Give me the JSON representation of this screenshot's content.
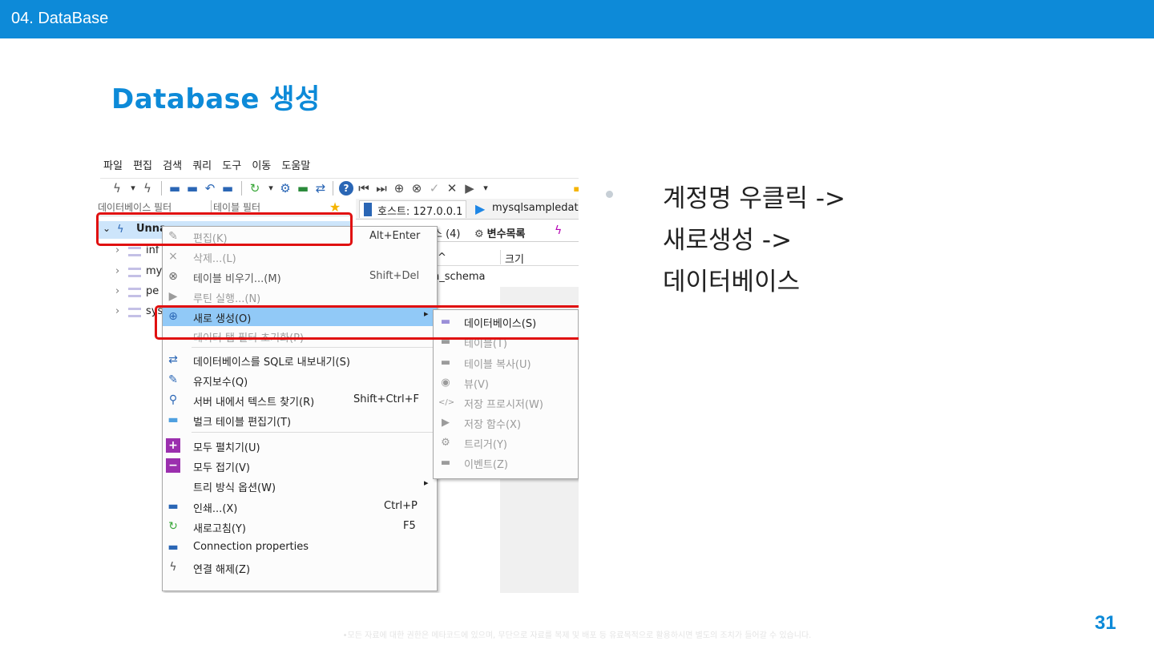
{
  "header": {
    "section": "04. DataBase"
  },
  "slide": {
    "title": "Database 생성",
    "bullet": [
      "계정명 우클릭 ->",
      "새로생성 ->",
      "데이터베이스"
    ],
    "page_number": "31",
    "footer_note": "•모든 자료에 대한 권한은 메타코드에 있으며, 무단으로 자료를 복제 및 배포 등 유료목적으로 활용하시면 별도의 조치가 들어갈 수 있습니다."
  },
  "app": {
    "menubar": [
      "파일",
      "편집",
      "검색",
      "쿼리",
      "도구",
      "이동",
      "도움말"
    ],
    "filters": {
      "database": "데이터베이스 필터",
      "table": "테이블 필터"
    },
    "tabs": {
      "host": "호스트: 127.0.0.1",
      "query": "mysqlsampledat"
    },
    "subtabs": {
      "databases": "스 (4)",
      "variables": "변수목록"
    },
    "grid": {
      "col_name": "^",
      "col_size": "크기",
      "row1": "n_schema"
    },
    "tree": {
      "session": "Unna",
      "items": [
        "inf",
        "my",
        "pe",
        "sys"
      ]
    },
    "context_menu": [
      {
        "label": "편집(K)",
        "shortcut": "Alt+Enter"
      },
      {
        "label": "삭제...(L)",
        "shortcut": ""
      },
      {
        "label": "테이블 비우기...(M)",
        "shortcut": "Shift+Del"
      },
      {
        "label": "루틴 실행...(N)",
        "shortcut": ""
      },
      {
        "label": "새로 생성(O)",
        "shortcut": ""
      },
      {
        "label": "데이터 탭 필터 초기화(P)",
        "shortcut": ""
      },
      {
        "label": "데이터베이스를 SQL로 내보내기(S)",
        "shortcut": ""
      },
      {
        "label": "유지보수(Q)",
        "shortcut": ""
      },
      {
        "label": "서버 내에서 텍스트 찾기(R)",
        "shortcut": "Shift+Ctrl+F"
      },
      {
        "label": "벌크 테이블 편집기(T)",
        "shortcut": ""
      },
      {
        "label": "모두 펼치기(U)",
        "shortcut": ""
      },
      {
        "label": "모두 접기(V)",
        "shortcut": ""
      },
      {
        "label": "트리 방식 옵션(W)",
        "shortcut": ""
      },
      {
        "label": "인쇄...(X)",
        "shortcut": "Ctrl+P"
      },
      {
        "label": "새로고침(Y)",
        "shortcut": "F5"
      },
      {
        "label": "Connection properties",
        "shortcut": ""
      },
      {
        "label": "연결 해제(Z)",
        "shortcut": ""
      }
    ],
    "submenu": [
      "데이터베이스(S)",
      "테이블(T)",
      "테이블 복사(U)",
      "뷰(V)",
      "저장 프로시저(W)",
      "저장 함수(X)",
      "트리거(Y)",
      "이벤트(Z)"
    ],
    "icons": {
      "delete": "×",
      "refresh": "↻",
      "plus": "+",
      "minus": "−",
      "print": "▬",
      "search": "⚲",
      "wrench": "✎",
      "gear": "⚙",
      "star": "★",
      "play": "▶",
      "chevron_down": "⌄",
      "chevron_right": "›",
      "submenu_arrow": "▸",
      "help": "?",
      "close": "✕",
      "check": "✓",
      "first": "⏮",
      "last": "⏭",
      "undo": "↶",
      "eye": "◉",
      "code": "</>",
      "arrows": "⇄",
      "bolt": "ϟ",
      "dropdown": "▾",
      "add": "⊕",
      "cancel": "⊗"
    },
    "colors": {
      "highlight": "#91c9f7",
      "selection": "#cde5fb",
      "annotation_red": "#e01010",
      "brand_blue": "#0d8ad8",
      "purple": "#9b2fae",
      "green": "#3aa83a"
    }
  }
}
